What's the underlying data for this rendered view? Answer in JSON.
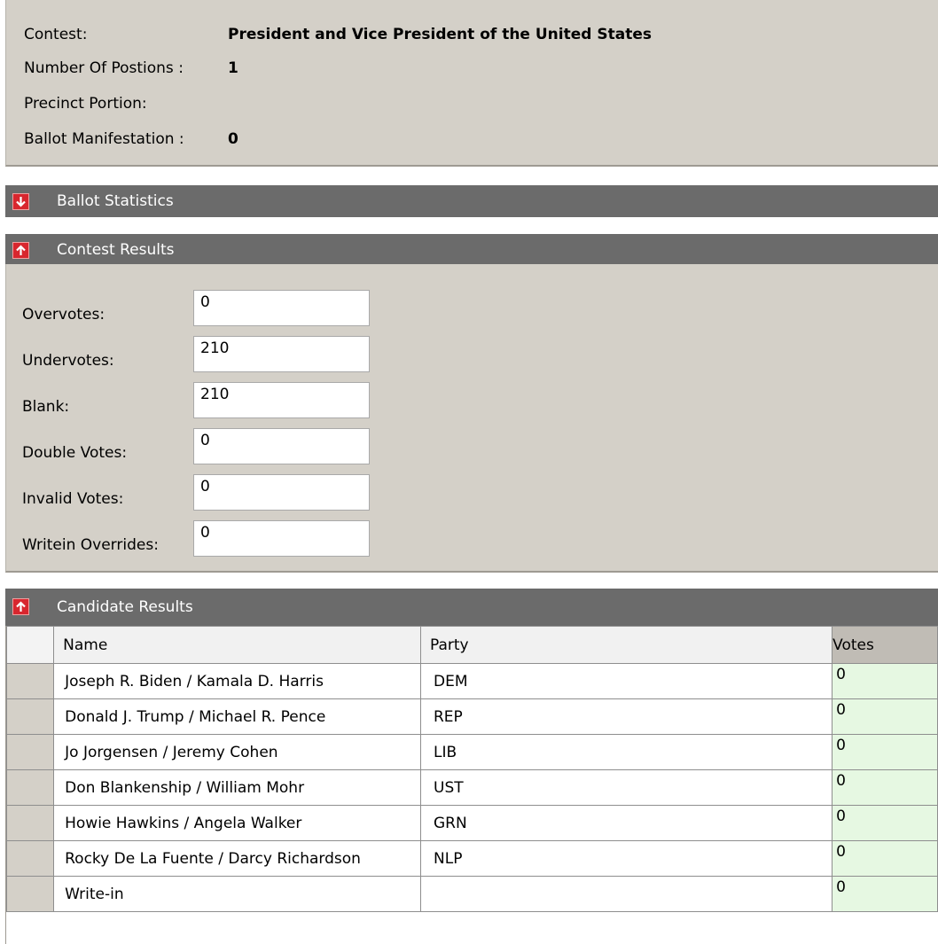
{
  "info": {
    "contest_label": "Contest:",
    "contest_value": "President and Vice President of the United States",
    "positions_label": "Number Of Postions :",
    "positions_value": "1",
    "precinct_label": "Precinct Portion:",
    "precinct_value": "",
    "ballot_label": "Ballot Manifestation :",
    "ballot_value": "0"
  },
  "sections": {
    "ballot_statistics": {
      "title": "Ballot Statistics",
      "state": "collapsed"
    },
    "contest_results": {
      "title": "Contest Results",
      "state": "expanded"
    },
    "candidate_results": {
      "title": "Candidate Results",
      "state": "expanded"
    }
  },
  "contest_results": {
    "overvotes_label": "Overvotes:",
    "overvotes_value": "0",
    "undervotes_label": "Undervotes:",
    "undervotes_value": "210",
    "blank_label": "Blank:",
    "blank_value": "210",
    "double_label": "Double Votes:",
    "double_value": "0",
    "invalid_label": "Invalid Votes:",
    "invalid_value": "0",
    "writein_label": "Writein Overrides:",
    "writein_value": "0"
  },
  "candidate_table": {
    "columns": [
      "Name",
      "Party",
      "Votes"
    ],
    "rows": [
      {
        "name": "Joseph R. Biden / Kamala D. Harris",
        "party": "DEM",
        "votes": "0"
      },
      {
        "name": "Donald J. Trump / Michael R. Pence",
        "party": "REP",
        "votes": "0"
      },
      {
        "name": "Jo Jorgensen / Jeremy Cohen",
        "party": "LIB",
        "votes": "0"
      },
      {
        "name": "Don Blankenship / William Mohr",
        "party": "UST",
        "votes": "0"
      },
      {
        "name": "Howie Hawkins / Angela Walker",
        "party": "GRN",
        "votes": "0"
      },
      {
        "name": "Rocky De La Fuente / Darcy Richardson",
        "party": "NLP",
        "votes": "0"
      },
      {
        "name": "Write-in",
        "party": "",
        "votes": "0"
      }
    ]
  },
  "colors": {
    "panel_bg": "#d4d0c8",
    "section_bar_bg": "#6b6b6b",
    "toggle_red": "#d8262e",
    "votes_cell_bg": "#e6f8e2"
  },
  "icons": {
    "collapsed_toggle": "arrow-down-icon",
    "expanded_toggle": "arrow-up-icon"
  }
}
